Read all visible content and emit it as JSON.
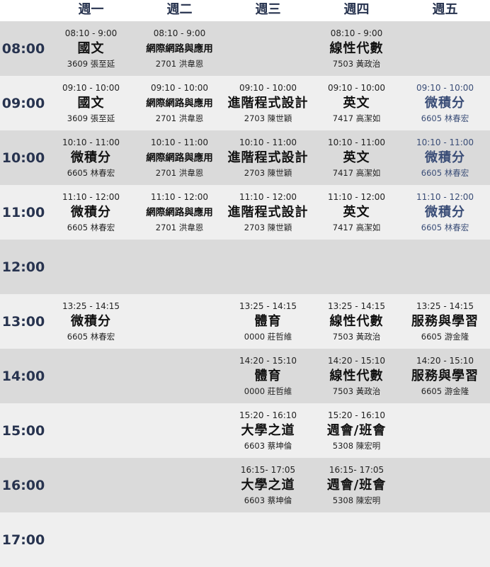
{
  "days": [
    "週一",
    "週二",
    "週三",
    "週四",
    "週五"
  ],
  "rows": [
    {
      "time": "08:00",
      "cells": [
        {
          "time": "08:10 - 9:00",
          "course": "國文",
          "room": "3609 張至延"
        },
        {
          "time": "08:10 - 9:00",
          "course": "網際網路與應用",
          "room": "2701 洪韋恩",
          "small": true
        },
        null,
        {
          "time": "08:10 - 9:00",
          "course": "線性代數",
          "room": "7503 黃政治"
        },
        null
      ]
    },
    {
      "time": "09:00",
      "cells": [
        {
          "time": "09:10 - 10:00",
          "course": "國文",
          "room": "3609 張至延"
        },
        {
          "time": "09:10 - 10:00",
          "course": "網際網路與應用",
          "room": "2701 洪韋恩",
          "small": true
        },
        {
          "time": "09:10 - 10:00",
          "course": "進階程式設計",
          "room": "2703 陳世穎"
        },
        {
          "time": "09:10 - 10:00",
          "course": "英文",
          "room": "7417 高潔如"
        },
        {
          "time": "09:10 - 10:00",
          "course": "微積分",
          "room": "6605 林春宏",
          "hl": true
        }
      ]
    },
    {
      "time": "10:00",
      "cells": [
        {
          "time": "10:10 - 11:00",
          "course": "微積分",
          "room": "6605 林春宏"
        },
        {
          "time": "10:10 - 11:00",
          "course": "網際網路與應用",
          "room": "2701 洪韋恩",
          "small": true
        },
        {
          "time": "10:10 - 11:00",
          "course": "進階程式設計",
          "room": "2703 陳世穎"
        },
        {
          "time": "10:10 - 11:00",
          "course": "英文",
          "room": "7417 高潔如"
        },
        {
          "time": "10:10 - 11:00",
          "course": "微積分",
          "room": "6605 林春宏",
          "hl": true
        }
      ]
    },
    {
      "time": "11:00",
      "cells": [
        {
          "time": "11:10 - 12:00",
          "course": "微積分",
          "room": "6605 林春宏"
        },
        {
          "time": "11:10 - 12:00",
          "course": "網際網路與應用",
          "room": "2701 洪韋恩",
          "small": true
        },
        {
          "time": "11:10 - 12:00",
          "course": "進階程式設計",
          "room": "2703 陳世穎"
        },
        {
          "time": "11:10 - 12:00",
          "course": "英文",
          "room": "7417 高潔如"
        },
        {
          "time": "11:10 - 12:00",
          "course": "微積分",
          "room": "6605 林春宏",
          "hl": true
        }
      ]
    },
    {
      "time": "12:00",
      "cells": [
        null,
        null,
        null,
        null,
        null
      ]
    },
    {
      "time": "13:00",
      "cells": [
        {
          "time": "13:25 - 14:15",
          "course": "微積分",
          "room": "6605 林春宏"
        },
        null,
        {
          "time": "13:25 - 14:15",
          "course": "體育",
          "room": "0000 莊哲維"
        },
        {
          "time": "13:25 - 14:15",
          "course": "線性代數",
          "room": "7503 黃政治"
        },
        {
          "time": "13:25 - 14:15",
          "course": "服務與學習",
          "room": "6605 游金隆"
        }
      ]
    },
    {
      "time": "14:00",
      "cells": [
        null,
        null,
        {
          "time": "14:20 - 15:10",
          "course": "體育",
          "room": "0000 莊哲維"
        },
        {
          "time": "14:20 - 15:10",
          "course": "線性代數",
          "room": "7503 黃政治"
        },
        {
          "time": "14:20 - 15:10",
          "course": "服務與學習",
          "room": "6605 游金隆"
        }
      ]
    },
    {
      "time": "15:00",
      "cells": [
        null,
        null,
        {
          "time": "15:20 - 16:10",
          "course": "大學之道",
          "room": "6603 蔡坤倫"
        },
        {
          "time": "15:20 - 16:10",
          "course": "週會/班會",
          "room": "5308 陳宏明"
        },
        null
      ]
    },
    {
      "time": "16:00",
      "cells": [
        null,
        null,
        {
          "time": "16:15- 17:05",
          "course": "大學之道",
          "room": "6603 蔡坤倫"
        },
        {
          "time": "16:15- 17:05",
          "course": "週會/班會",
          "room": "5308 陳宏明"
        },
        null
      ]
    },
    {
      "time": "17:00",
      "cells": [
        null,
        null,
        null,
        null,
        null
      ]
    }
  ]
}
